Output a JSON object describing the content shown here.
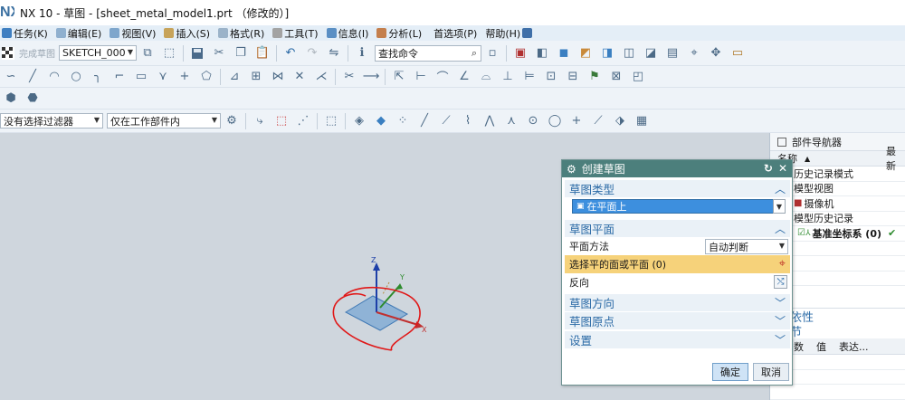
{
  "window": {
    "app_logo": "NX",
    "title": "NX 10 - 草图 - [sheet_metal_model1.prt （修改的）]"
  },
  "menu": {
    "items": [
      {
        "label": "任务(K)",
        "icon": "task-icon"
      },
      {
        "label": "编辑(E)",
        "icon": "edit-icon"
      },
      {
        "label": "视图(V)",
        "icon": "view-icon"
      },
      {
        "label": "插入(S)",
        "icon": "insert-icon"
      },
      {
        "label": "格式(R)",
        "icon": "format-icon"
      },
      {
        "label": "工具(T)",
        "icon": "tools-icon"
      },
      {
        "label": "信息(I)",
        "icon": "info-icon"
      },
      {
        "label": "分析(L)",
        "icon": "analysis-icon"
      },
      {
        "label": "首选项(P)",
        "icon": ""
      },
      {
        "label": "帮助(H)",
        "icon": "help-icon"
      }
    ]
  },
  "toolbar": {
    "finish_sketch_label": "完成草图",
    "sketch_name": "SKETCH_000",
    "command_search_placeholder": "查找命令"
  },
  "selection_bar": {
    "filter_value": "没有选择过滤器",
    "scope_value": "仅在工作部件内"
  },
  "navigator": {
    "title": "部件导航器",
    "col_name": "名称",
    "col_latest": "最新",
    "rows": [
      {
        "label": "历史记录模式",
        "icon": ""
      },
      {
        "label": "模型视图",
        "icon": ""
      },
      {
        "label": "摄像机",
        "icon": "camera-icon"
      },
      {
        "label": "模型历史记录",
        "icon": ""
      },
      {
        "label": "基准坐标系 (0)",
        "icon": "datum-csys-icon",
        "check": "✔"
      }
    ],
    "dependency_title": "依性",
    "details_title": "节",
    "details_cols": [
      "数",
      "值",
      "表达..."
    ]
  },
  "dialog": {
    "title": "创建草图",
    "section_type": "草图类型",
    "type_value": "在平面上",
    "section_plane": "草图平面",
    "plane_method_label": "平面方法",
    "plane_method_value": "自动判断",
    "select_face_label": "选择平的面或平面 (0)",
    "reverse_label": "反向",
    "section_orientation": "草图方向",
    "section_origin": "草图原点",
    "section_settings": "设置",
    "ok_label": "确定",
    "cancel_label": "取消"
  },
  "triad": {
    "z_label": "Z",
    "y_label": "Y",
    "x_label": "X"
  },
  "colors": {
    "dialog_title_bg": "#4c7f7c",
    "section_text": "#2b6aa6",
    "highlight_row": "#f6d27a",
    "viewport_bg": "#cfd6dd",
    "annotation_red": "#e01818"
  }
}
